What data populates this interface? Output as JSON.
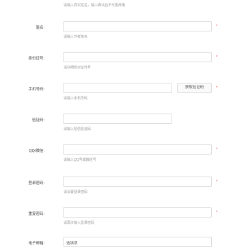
{
  "top_hint": "请输入真实姓名，输入确认后不可更改哦",
  "required_mark": "*",
  "fields": {
    "pen_name": {
      "label": "笔名:",
      "hint": "请输入作者笔名",
      "value": ""
    },
    "id_card": {
      "label": "身份证号:",
      "hint": "请仔细核对证件号",
      "value": ""
    },
    "phone": {
      "label": "手机号码:",
      "hint": "请输入手机号码",
      "value": "",
      "button": "获取验证码"
    },
    "verify": {
      "label": "验证码:",
      "hint": "请输入短信验证码",
      "value": ""
    },
    "qq": {
      "label": "QQ/微信:",
      "hint": "请输入QQ号或微信号",
      "value": ""
    },
    "password": {
      "label": "登录密码:",
      "hint": "请设置登录密码",
      "value": ""
    },
    "repassword": {
      "label": "重复密码:",
      "hint": "请再次输入登录密码",
      "value": ""
    },
    "email": {
      "label": "电子邮箱:",
      "value": "选填项"
    }
  }
}
